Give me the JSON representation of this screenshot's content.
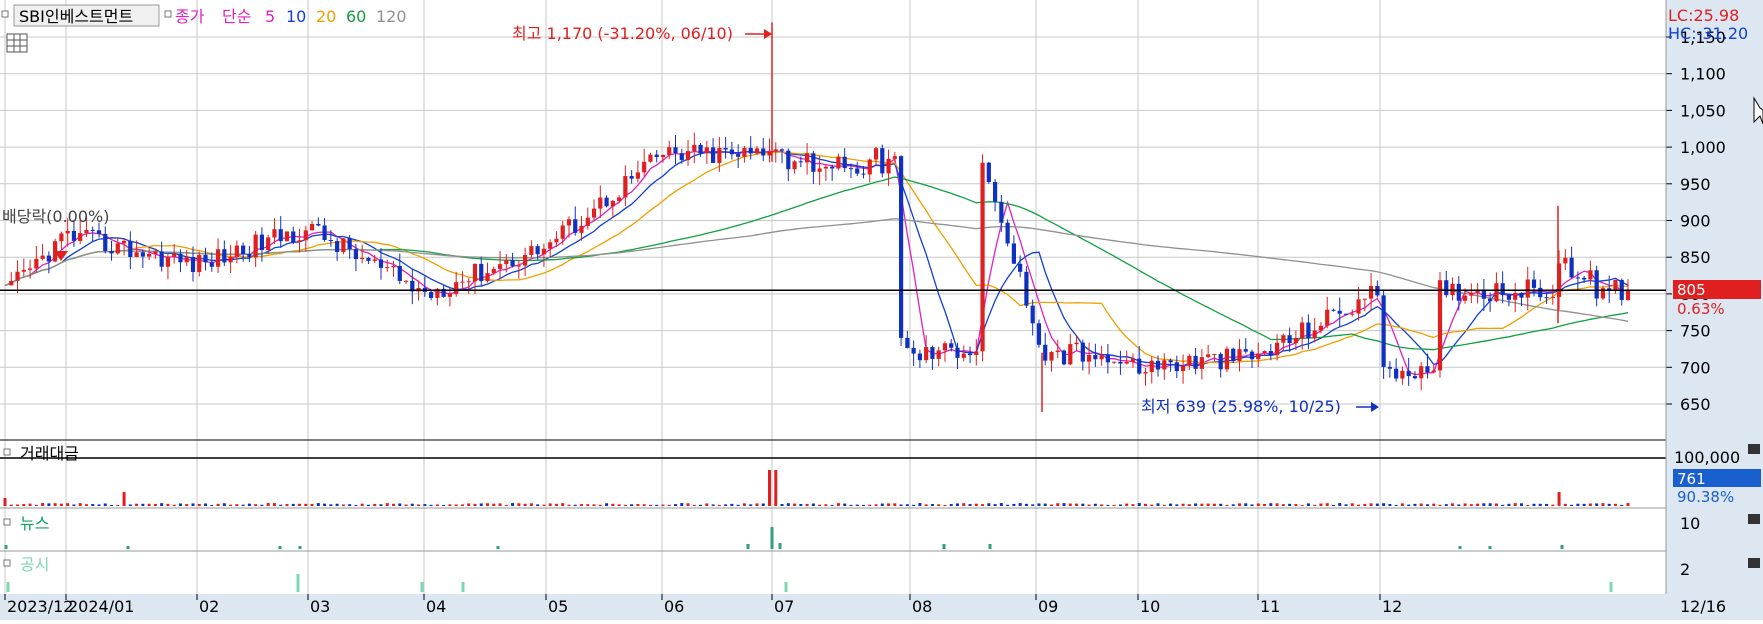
{
  "header": {
    "stock_name": "SBI인베스트먼트",
    "price_label": "종가",
    "ma_type": "단순",
    "ma_periods": [
      "5",
      "10",
      "20",
      "60",
      "120"
    ],
    "ma_colors": [
      "#e020c0",
      "#1040d8",
      "#f0a000",
      "#10a040",
      "#909090"
    ]
  },
  "right_panel": {
    "lc": "LC:25.98",
    "hc": "HC:-31.20",
    "price_tag": "805",
    "price_pct": "0.63%",
    "volume_tag": "761",
    "volume_pct": "90.38%",
    "volume_axis_label": "100,000",
    "news_axis_label": "10",
    "disclosure_axis_label": "2",
    "date_label": "12/16"
  },
  "annotations": {
    "high": "최고 1,170 (-31.20%, 06/10)",
    "low": "최저 639 (25.98%, 10/25)",
    "dividend": "배당락(0.00%)"
  },
  "panels": {
    "volume_title": "거래대금",
    "news_title": "뉴스",
    "disclosure_title": "공시"
  },
  "colors": {
    "up": "#e02020",
    "down": "#1030c0",
    "grid": "#c8c8c8",
    "panel_bg": "#dde7f2",
    "volume_tag": "#1a5fd0",
    "price_tag": "#e02020"
  },
  "chart_data": {
    "type": "candlestick",
    "title": "SBI인베스트먼트",
    "y_ticks": [
      650,
      700,
      750,
      800,
      850,
      900,
      950,
      1000,
      1050,
      1100,
      1150
    ],
    "ylim": [
      600,
      1170
    ],
    "x_month_labels": [
      "2023/12",
      "2024/01",
      "02",
      "03",
      "04",
      "05",
      "06",
      "07",
      "08",
      "09",
      "10",
      "11",
      "12"
    ],
    "current_price": 805,
    "period_high": {
      "value": 1170,
      "date": "06/10",
      "pct": -31.2
    },
    "period_low": {
      "value": 639,
      "date": "10/25",
      "pct": 25.98
    },
    "price_path_approx": [
      {
        "month": "2023/12",
        "close": 800
      },
      {
        "month": "2024/01",
        "close": 880
      },
      {
        "month": "02",
        "close": 840
      },
      {
        "month": "03",
        "close": 890
      },
      {
        "month": "04",
        "close": 800
      },
      {
        "month": "05",
        "close": 865
      },
      {
        "month": "06",
        "close": 990
      },
      {
        "month": "07",
        "close": 990
      },
      {
        "month": "08",
        "close": 715
      },
      {
        "month": "09",
        "close": 740
      },
      {
        "month": "10",
        "close": 700
      },
      {
        "month": "11",
        "close": 715
      },
      {
        "month": "12",
        "close": 805
      }
    ]
  }
}
